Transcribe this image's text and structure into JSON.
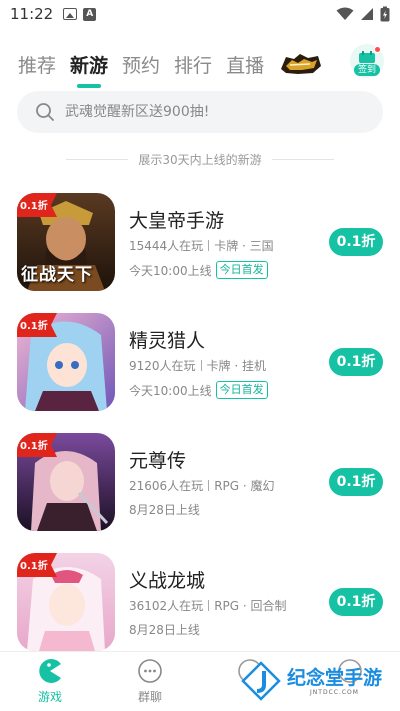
{
  "status_bar": {
    "time": "11:22",
    "notif_letter": "A"
  },
  "tabs": [
    {
      "label": "推荐",
      "active": false
    },
    {
      "label": "新游",
      "active": true
    },
    {
      "label": "预约",
      "active": false
    },
    {
      "label": "排行",
      "active": false
    },
    {
      "label": "直播",
      "active": false
    }
  ],
  "checkin_label": "签到",
  "search": {
    "placeholder": "武魂觉醒新区送900抽!"
  },
  "section_header": "展示30天内上线的新游",
  "games": [
    {
      "title": "大皇帝手游",
      "players": "15444人在玩",
      "tags": "卡牌 · 三国",
      "date": "今天10:00上线",
      "badge": "今日首发",
      "discount": "0.1折",
      "cover_badge": "0.1折",
      "cover_text": "征战天下"
    },
    {
      "title": "精灵猎人",
      "players": "9120人在玩",
      "tags": "卡牌 · 挂机",
      "date": "今天10:00上线",
      "badge": "今日首发",
      "discount": "0.1折",
      "cover_badge": "0.1折"
    },
    {
      "title": "元尊传",
      "players": "21606人在玩",
      "tags": "RPG · 魔幻",
      "date": "8月28日上线",
      "badge": "",
      "discount": "0.1折",
      "cover_badge": "0.1折"
    },
    {
      "title": "义战龙城",
      "players": "36102人在玩",
      "tags": "RPG · 回合制",
      "date": "8月28日上线",
      "badge": "",
      "discount": "0.1折",
      "cover_badge": "0.1折"
    }
  ],
  "bottom_nav": [
    {
      "label": "游戏",
      "active": true
    },
    {
      "label": "群聊",
      "active": false
    },
    {
      "label": "",
      "active": false
    },
    {
      "label": "",
      "active": false
    }
  ],
  "watermark": {
    "text": "纪念堂手游",
    "sub": "JNTDCC.COM"
  },
  "colors": {
    "accent": "#16c2a3",
    "badge_red": "#e0251c"
  }
}
